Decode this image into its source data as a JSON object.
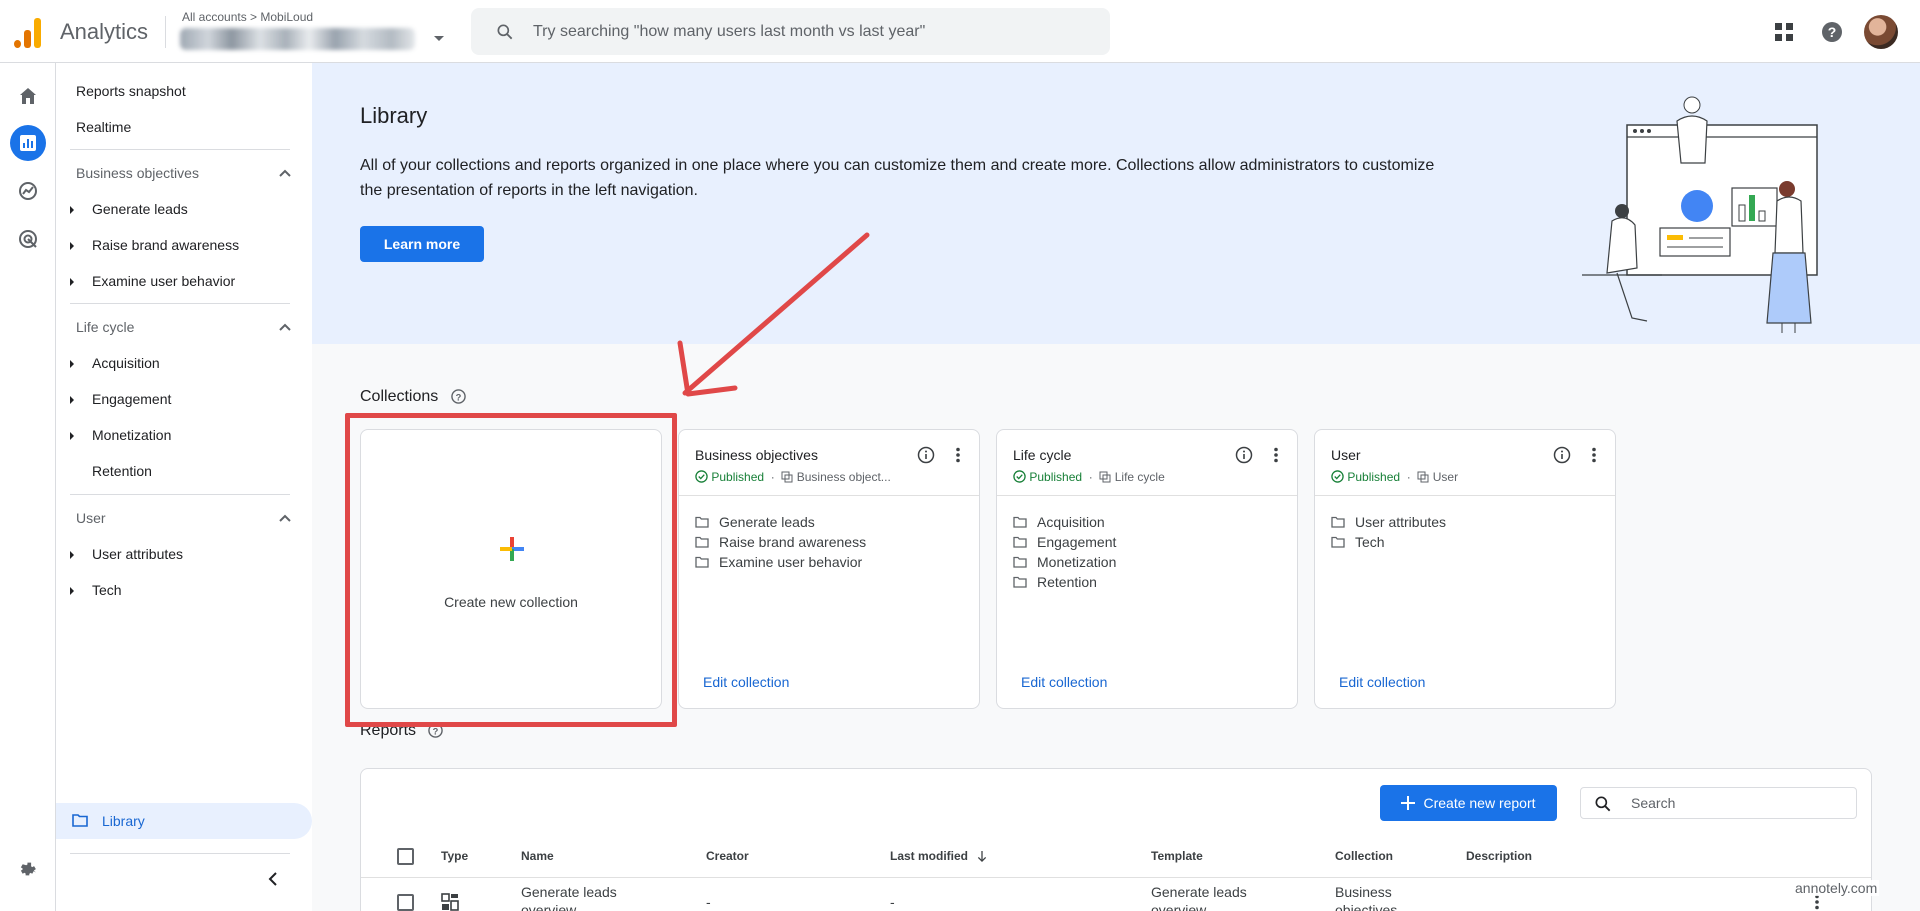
{
  "header": {
    "app_name": "Analytics",
    "breadcrumb": "All accounts > MobiLoud",
    "search_placeholder": "Try searching \"how many users last month vs last year\""
  },
  "sidebar": {
    "reports_snapshot": "Reports snapshot",
    "realtime": "Realtime",
    "sections": [
      {
        "title": "Business objectives",
        "items": [
          "Generate leads",
          "Raise brand awareness",
          "Examine user behavior"
        ]
      },
      {
        "title": "Life cycle",
        "items": [
          "Acquisition",
          "Engagement",
          "Monetization",
          "Retention"
        ]
      },
      {
        "title": "User",
        "items": [
          "User attributes",
          "Tech"
        ]
      }
    ],
    "library": "Library"
  },
  "hero": {
    "title": "Library",
    "description": "All of your collections and reports organized in one place where you can customize them and create more. Collections allow administrators to customize the presentation of reports in the left navigation.",
    "learn_more": "Learn more"
  },
  "collections": {
    "title": "Collections",
    "create_label": "Create new collection",
    "cards": [
      {
        "title": "Business objectives",
        "status": "Published",
        "template": "Business object...",
        "items": [
          "Generate leads",
          "Raise brand awareness",
          "Examine user behavior"
        ],
        "edit": "Edit collection"
      },
      {
        "title": "Life cycle",
        "status": "Published",
        "template": "Life cycle",
        "items": [
          "Acquisition",
          "Engagement",
          "Monetization",
          "Retention"
        ],
        "edit": "Edit collection"
      },
      {
        "title": "User",
        "status": "Published",
        "template": "User",
        "items": [
          "User attributes",
          "Tech"
        ],
        "edit": "Edit collection"
      }
    ]
  },
  "reports": {
    "title": "Reports",
    "create_button": "Create new report",
    "search_placeholder": "Search",
    "columns": [
      "Type",
      "Name",
      "Creator",
      "Last modified",
      "Template",
      "Collection",
      "Description"
    ],
    "rows": [
      {
        "name": "Generate leads overview",
        "creator": "-",
        "last_modified": "-",
        "template": "Generate leads overview",
        "collection": "Business objectives",
        "description": ""
      }
    ]
  },
  "watermark": "annotely.com",
  "colors": {
    "accent": "#1a73e8",
    "highlight": "#e04848",
    "published": "#188038"
  }
}
